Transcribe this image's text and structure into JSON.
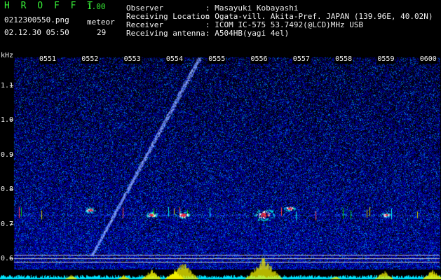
{
  "app": {
    "name": "H R O F F T",
    "version": "1.00"
  },
  "file": {
    "name": "0212300550.png",
    "datetime": "02.12.30 05:50"
  },
  "meteor": {
    "label": "meteor",
    "count": "29"
  },
  "station": [
    {
      "key": "Observer",
      "value": ": Masayuki Kobayashi"
    },
    {
      "key": "Receiving Location",
      "value": ": Ogata-vill. Akita-Pref. JAPAN (139.96E, 40.02N)"
    },
    {
      "key": "Receiver",
      "value": ": ICOM IC-575 53.7492(@LCD)MHz USB"
    },
    {
      "key": "Receiving antenna",
      "value": ": A504HB(yagi 4el)"
    }
  ],
  "colors": {
    "header_text": "#38f038",
    "background": "#000000",
    "axis_text": "#f2f2f2"
  },
  "chart_data": {
    "type": "heatmap",
    "title": "",
    "ylabel": "kHz",
    "xlabel": "",
    "x_ticks": [
      "0551",
      "0552",
      "0553",
      "0554",
      "0555",
      "0556",
      "0557",
      "0558",
      "0559",
      "0600"
    ],
    "y_ticks": [
      "1.1",
      "1.0",
      "0.9",
      "0.8",
      "0.7",
      "0.6"
    ],
    "y_tick_values": [
      1.1,
      1.0,
      0.9,
      0.8,
      0.7,
      0.6
    ],
    "ylim": [
      0.57,
      1.18
    ],
    "xlim_minutes": [
      0,
      10
    ],
    "carrier_khz": 0.725,
    "echoes": [
      {
        "kind": "long_trail",
        "start_min": 1.05,
        "start_khz": 0.61,
        "end_min": 3.6,
        "end_khz": 1.18
      },
      {
        "kind": "burst",
        "min": 5.12,
        "khz": 0.726,
        "strength": 1.0
      },
      {
        "kind": "burst",
        "min": 3.2,
        "khz": 0.726,
        "strength": 0.55
      },
      {
        "kind": "burst",
        "min": 2.45,
        "khz": 0.726,
        "strength": 0.35
      },
      {
        "kind": "burst",
        "min": 1.0,
        "khz": 0.74,
        "strength": 0.3
      },
      {
        "kind": "burst",
        "min": 5.72,
        "khz": 0.745,
        "strength": 0.3
      },
      {
        "kind": "burst",
        "min": 8.0,
        "khz": 0.726,
        "strength": 0.25
      },
      {
        "kind": "burst",
        "min": 9.55,
        "khz": 0.74,
        "strength": 0.25
      }
    ],
    "signal_level_peaks": [
      {
        "min": 5.1,
        "level": 1.0
      },
      {
        "min": 3.2,
        "level": 0.8
      },
      {
        "min": 2.45,
        "level": 0.45
      },
      {
        "min": 3.0,
        "level": 0.45
      },
      {
        "min": 7.95,
        "level": 0.4
      },
      {
        "min": 9.1,
        "level": 0.45
      },
      {
        "min": 0.55,
        "level": 0.2
      },
      {
        "min": 1.8,
        "level": 0.2
      },
      {
        "min": 6.8,
        "level": 0.15
      }
    ]
  }
}
